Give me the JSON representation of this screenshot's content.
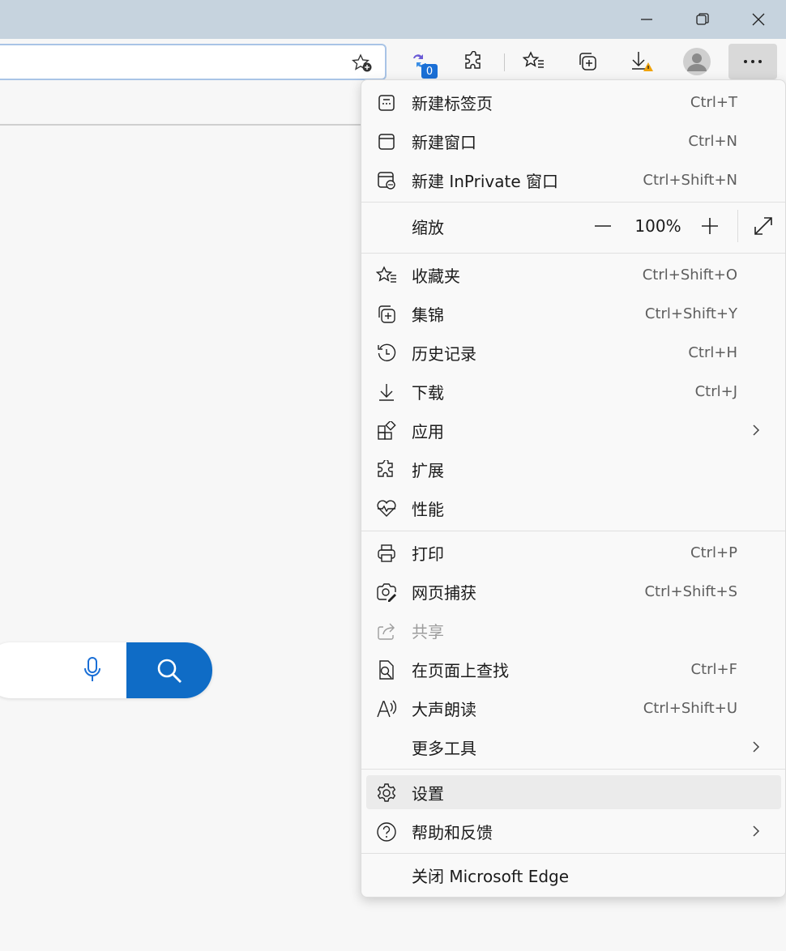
{
  "window": {
    "controls": [
      "minimize-icon",
      "restore-icon",
      "close-icon"
    ]
  },
  "toolbar": {
    "badge_count": "0",
    "icons": [
      "add-favorite-icon",
      "copilot-icon",
      "extensions-icon",
      "favorites-icon",
      "collections-icon",
      "downloads-icon",
      "profile-icon",
      "more-icon"
    ]
  },
  "menu": {
    "items": [
      {
        "label": "新建标签页",
        "shortcut": "Ctrl+T",
        "icon": "new-tab-icon"
      },
      {
        "label": "新建窗口",
        "shortcut": "Ctrl+N",
        "icon": "new-window-icon"
      },
      {
        "label": "新建 InPrivate 窗口",
        "shortcut": "Ctrl+Shift+N",
        "icon": "inprivate-icon"
      }
    ],
    "zoom": {
      "label": "缩放",
      "value": "100%"
    },
    "items2": [
      {
        "label": "收藏夹",
        "shortcut": "Ctrl+Shift+O",
        "icon": "favorites-icon"
      },
      {
        "label": "集锦",
        "shortcut": "Ctrl+Shift+Y",
        "icon": "collections-icon"
      },
      {
        "label": "历史记录",
        "shortcut": "Ctrl+H",
        "icon": "history-icon"
      },
      {
        "label": "下载",
        "shortcut": "Ctrl+J",
        "icon": "download-icon"
      },
      {
        "label": "应用",
        "shortcut": "",
        "icon": "apps-icon"
      },
      {
        "label": "扩展",
        "shortcut": "",
        "icon": "extensions-icon"
      },
      {
        "label": "性能",
        "shortcut": "",
        "icon": "performance-icon"
      }
    ],
    "items3": [
      {
        "label": "打印",
        "shortcut": "Ctrl+P",
        "icon": "print-icon"
      },
      {
        "label": "网页捕获",
        "shortcut": "Ctrl+Shift+S",
        "icon": "web-capture-icon"
      },
      {
        "label": "共享",
        "shortcut": "",
        "icon": "share-icon"
      },
      {
        "label": "在页面上查找",
        "shortcut": "Ctrl+F",
        "icon": "find-icon"
      },
      {
        "label": "大声朗读",
        "shortcut": "Ctrl+Shift+U",
        "icon": "read-aloud-icon"
      },
      {
        "label": "更多工具",
        "shortcut": "",
        "icon": ""
      }
    ],
    "items4": [
      {
        "label": "设置",
        "shortcut": "",
        "icon": "settings-icon"
      },
      {
        "label": "帮助和反馈",
        "shortcut": "",
        "icon": "help-icon"
      }
    ],
    "close": {
      "label": "关闭 Microsoft Edge"
    }
  },
  "colors": {
    "titlebar": "#c6d3de",
    "accent": "#0f6cc6",
    "highlight": "#ebebeb"
  }
}
